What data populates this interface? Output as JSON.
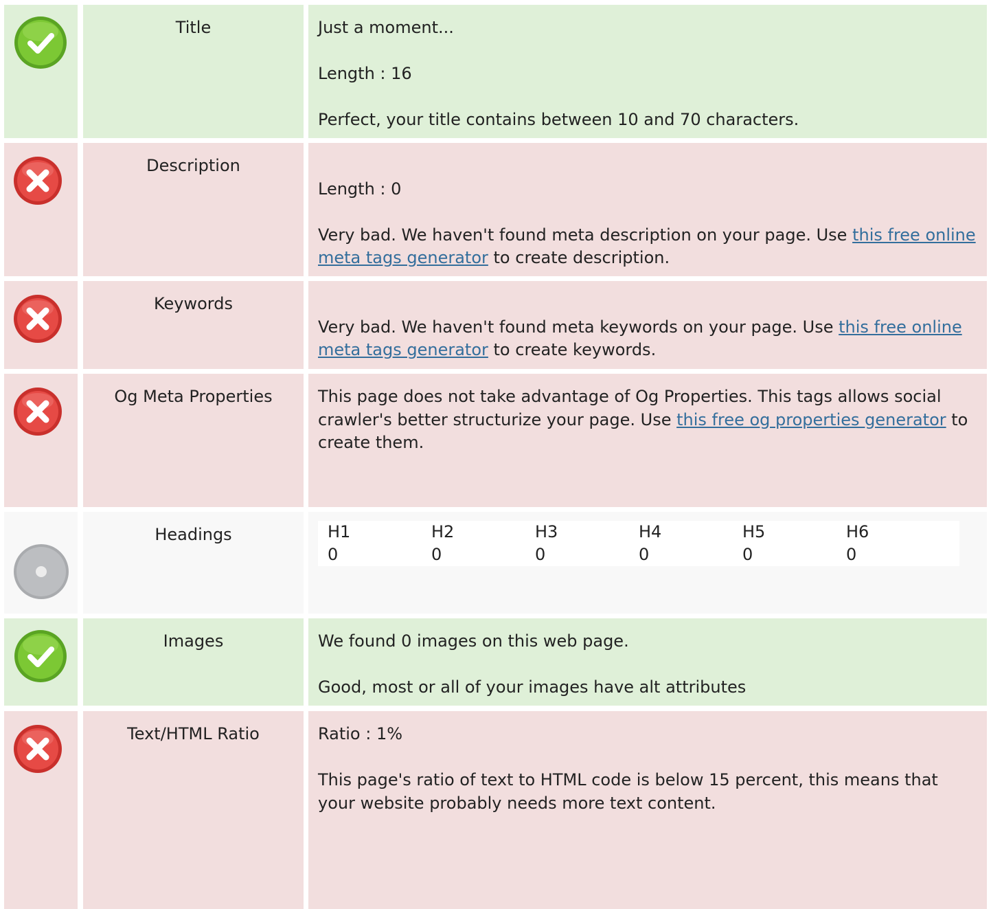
{
  "colors": {
    "good": "#dff0d8",
    "bad": "#f2dede",
    "neutral": "#f8f8f8",
    "link": "#336e9c"
  },
  "rows": {
    "title": {
      "status_icon": "check-icon",
      "name": "Title",
      "value": "Just a moment...",
      "length": "Length : 16",
      "message": "Perfect, your title contains between 10 and 70 characters."
    },
    "description": {
      "status_icon": "error-icon",
      "name": "Description",
      "length": "Length : 0",
      "msg_before": "Very bad. We haven't found meta description on your page. Use ",
      "link": "this free online meta tags generator",
      "msg_after": " to create description."
    },
    "keywords": {
      "status_icon": "error-icon",
      "name": "Keywords",
      "msg_before": "Very bad. We haven't found meta keywords on your page. Use ",
      "link": "this free online meta tags generator",
      "msg_after": " to create keywords."
    },
    "og": {
      "status_icon": "error-icon",
      "name": "Og Meta Properties",
      "msg_before": "This page does not take advantage of Og Properties. This tags allows social crawler's better structurize your page. Use ",
      "link": "this free og properties generator",
      "msg_after": " to create them."
    },
    "headings": {
      "status_icon": "neutral-icon",
      "name": "Headings",
      "labels": [
        "H1",
        "H2",
        "H3",
        "H4",
        "H5",
        "H6"
      ],
      "counts": [
        "0",
        "0",
        "0",
        "0",
        "0",
        "0"
      ]
    },
    "images": {
      "status_icon": "check-icon",
      "name": "Images",
      "found": "We found 0 images on this web page.",
      "message": "Good, most or all of your images have alt attributes"
    },
    "ratio": {
      "status_icon": "error-icon",
      "name": "Text/HTML Ratio",
      "value": "Ratio : 1%",
      "message": "This page's ratio of text to HTML code is below 15 percent, this means that your website probably needs more text content."
    }
  }
}
